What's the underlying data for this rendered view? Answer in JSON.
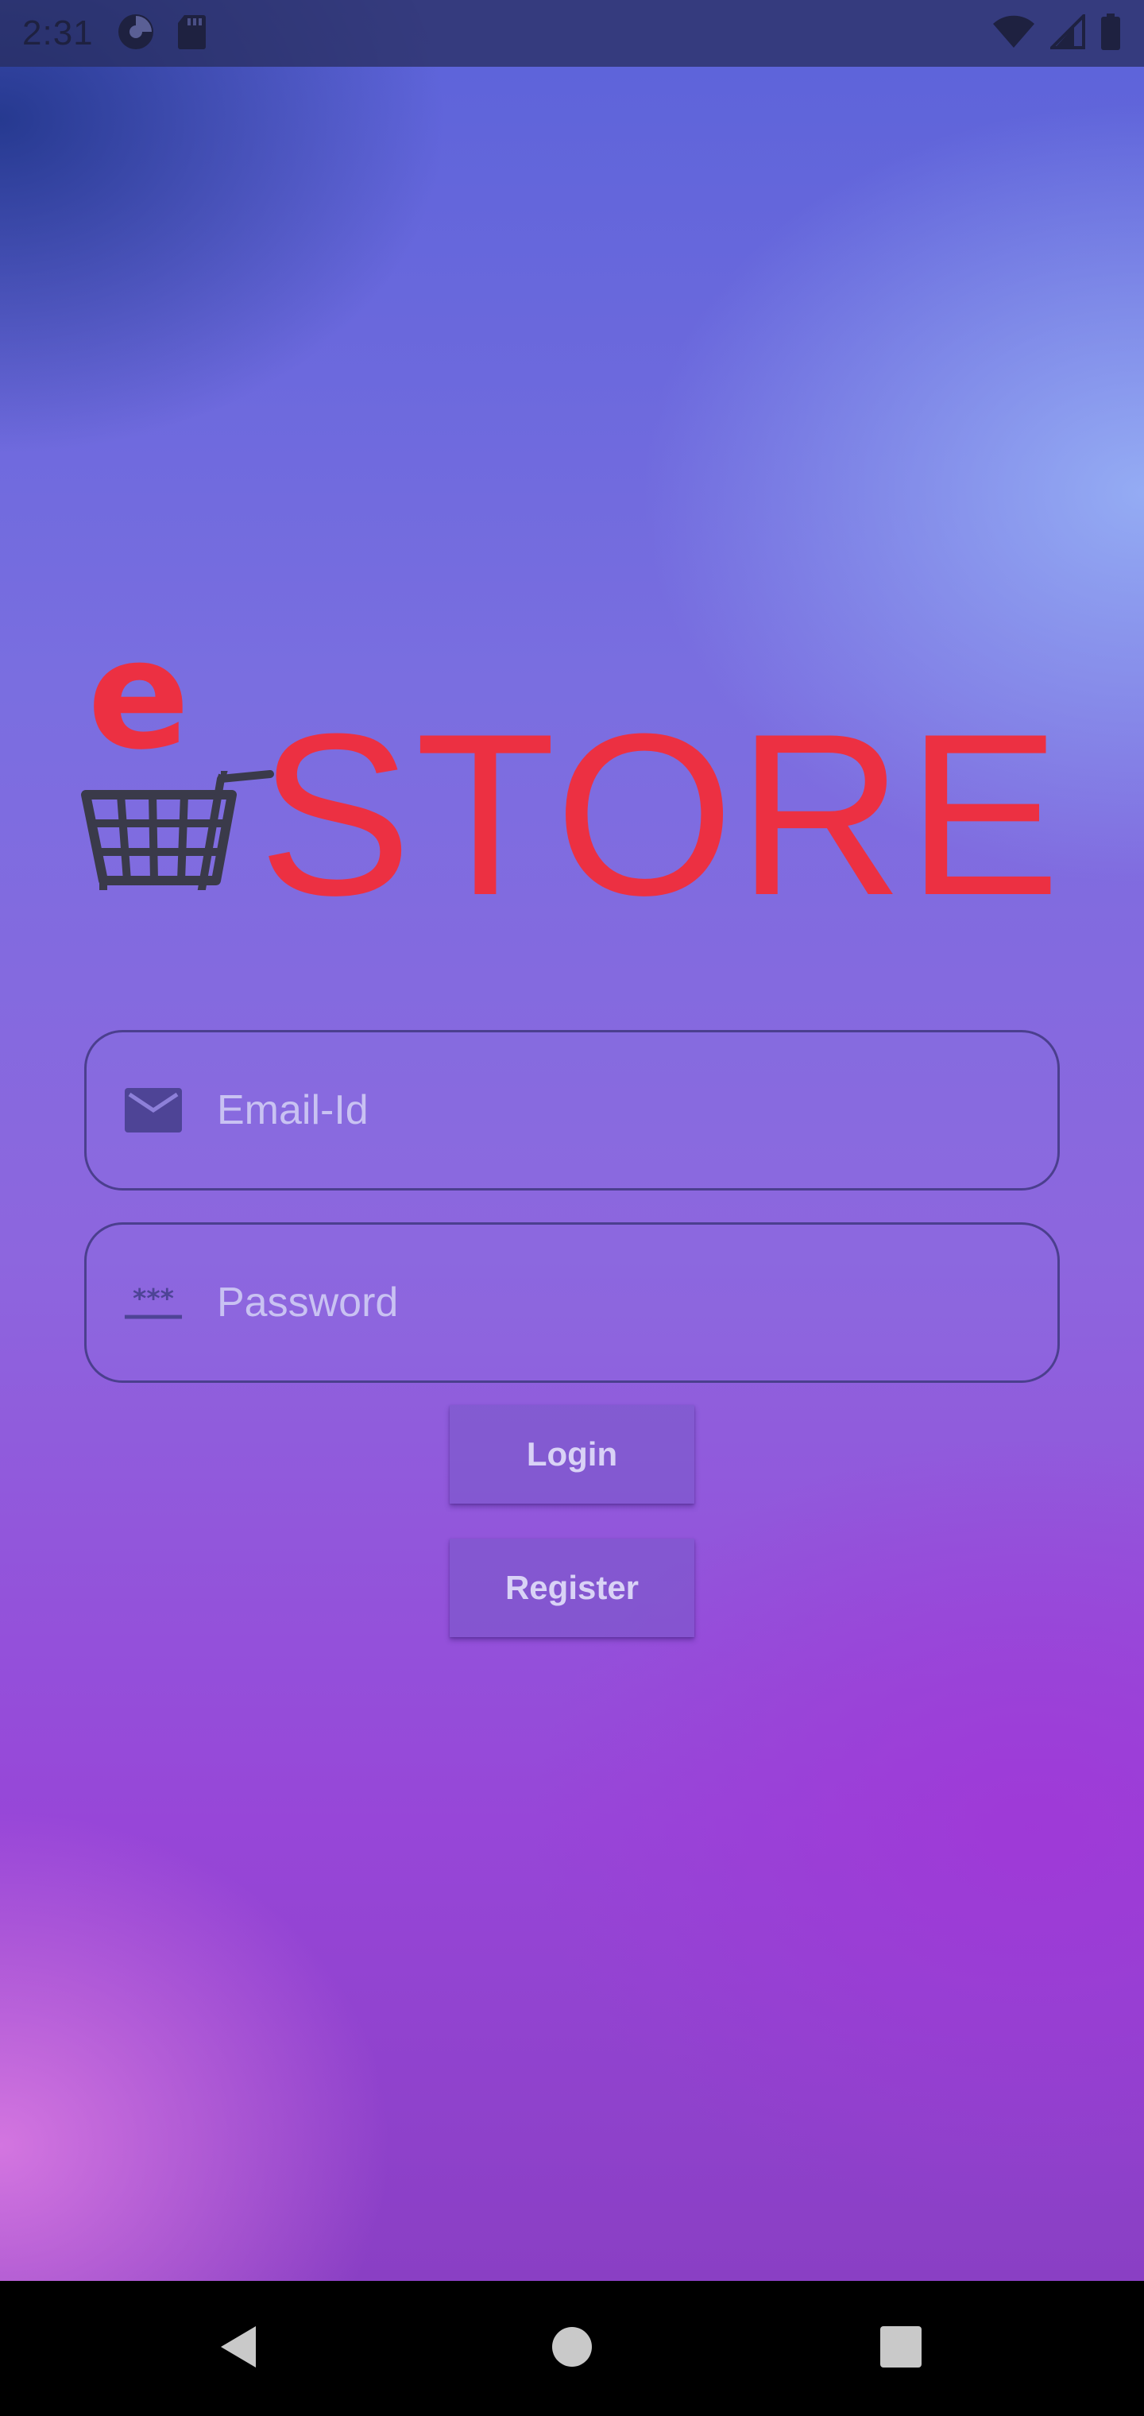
{
  "status_bar": {
    "time": "2:31",
    "left_icons": [
      "data-saver-icon",
      "sd-card-icon"
    ],
    "right_icons": [
      "wifi-icon",
      "signal-icon",
      "battery-icon"
    ]
  },
  "logo": {
    "letter_e": "e",
    "word": "STORE",
    "color": "#ec3042"
  },
  "form": {
    "email": {
      "placeholder": "Email-Id",
      "value": ""
    },
    "password": {
      "placeholder": "Password",
      "value": "",
      "icon_text": "***"
    }
  },
  "buttons": {
    "login_label": "Login",
    "register_label": "Register"
  },
  "nav_bar": {
    "items": [
      "back-icon",
      "home-icon",
      "recents-icon"
    ]
  }
}
